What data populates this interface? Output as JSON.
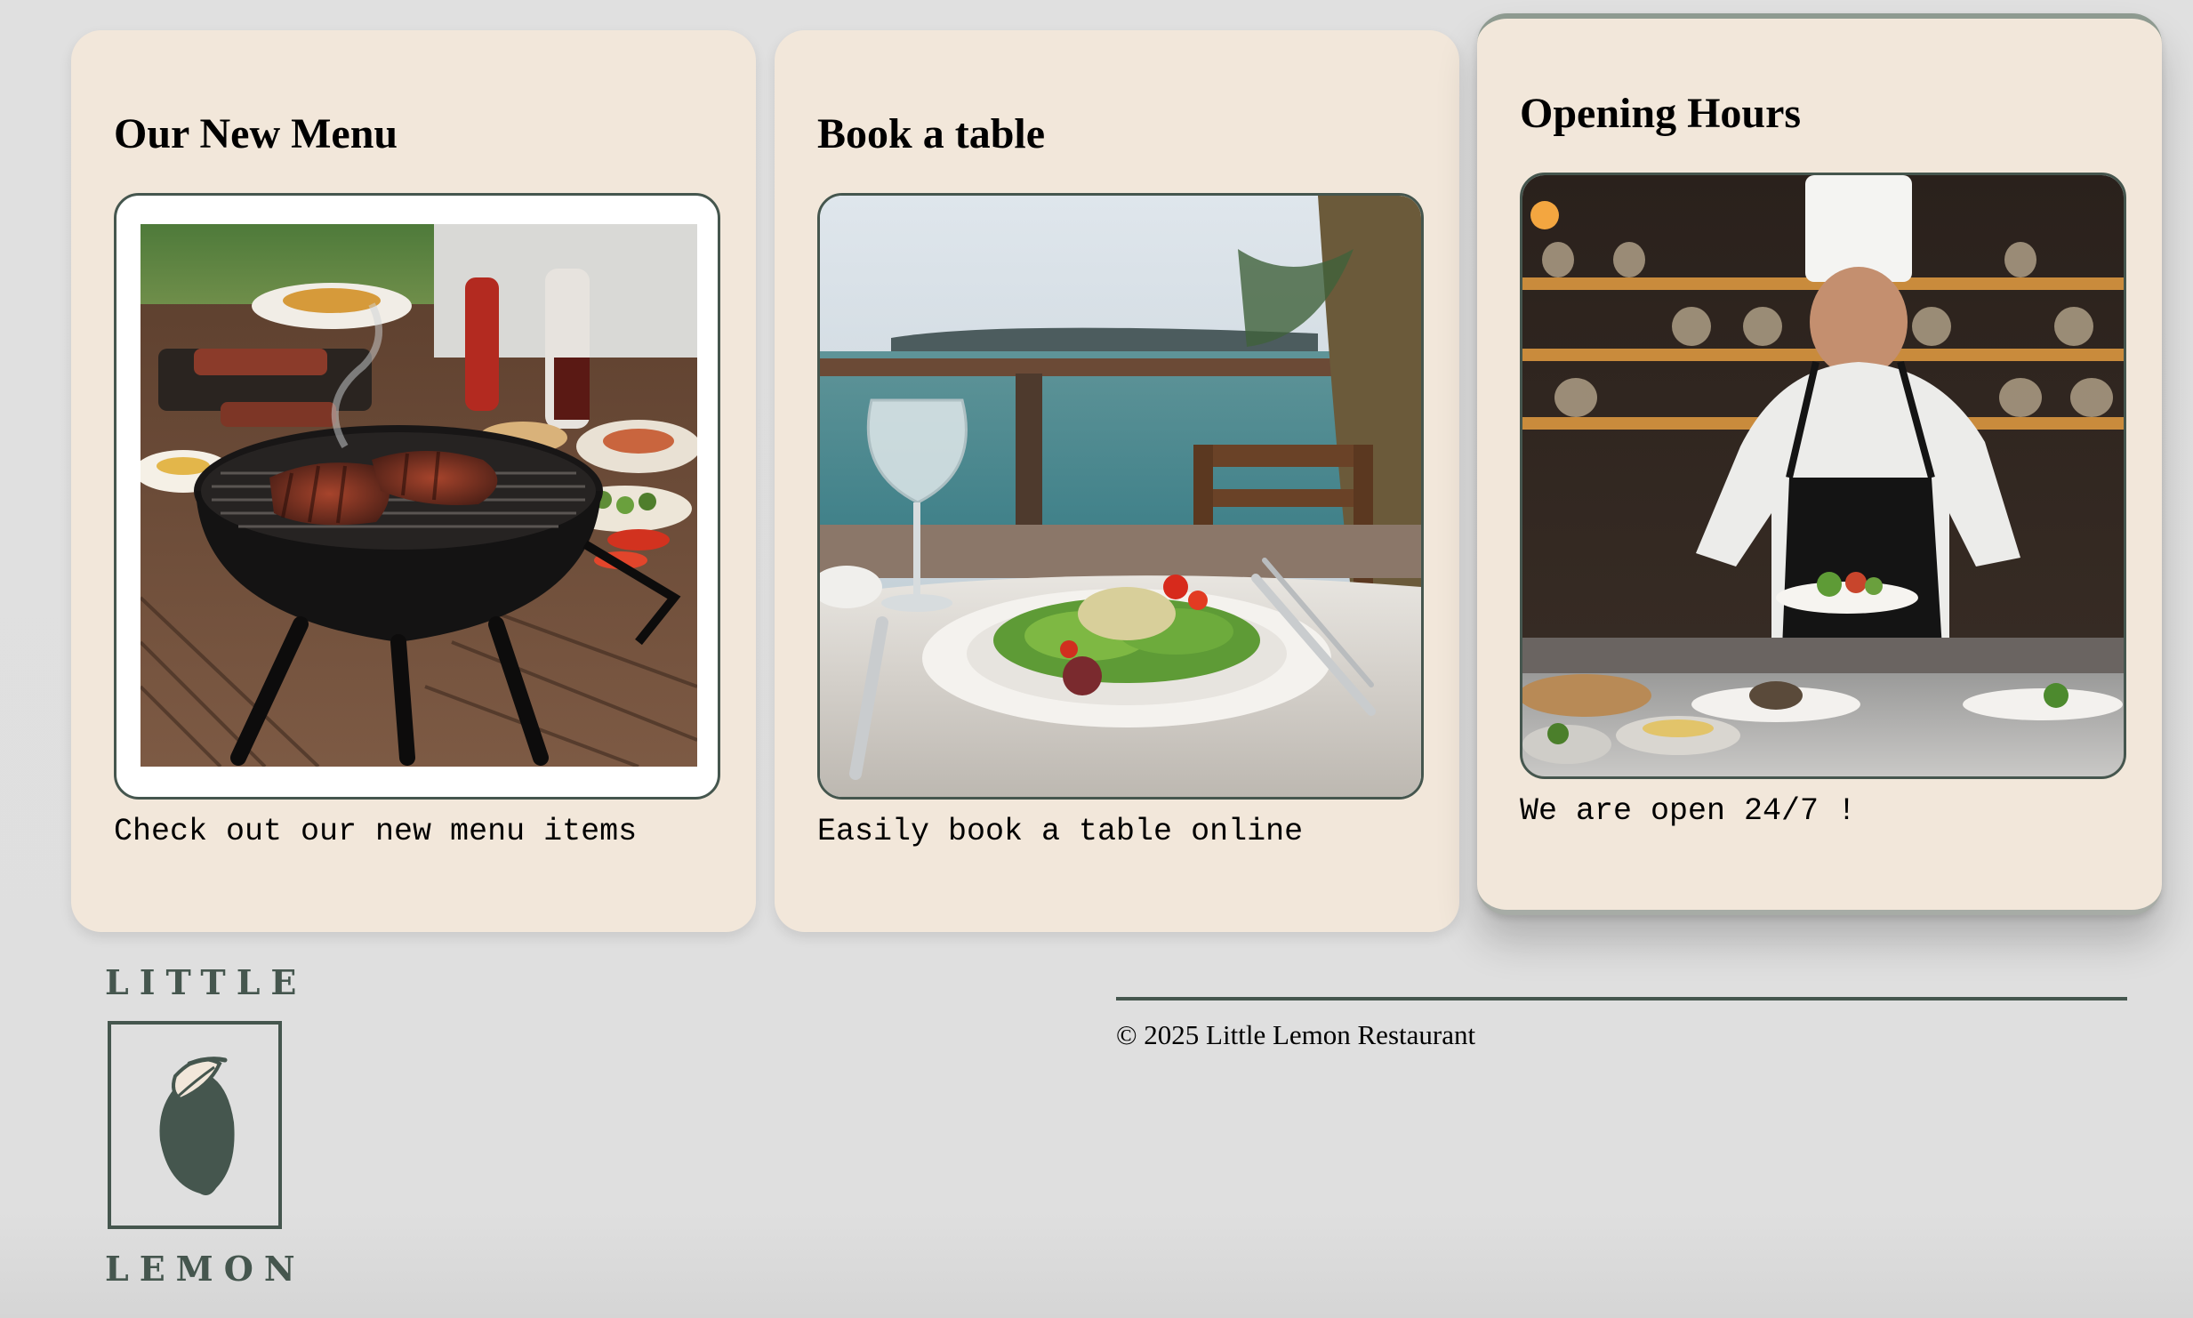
{
  "cards": [
    {
      "title": "Our New Menu",
      "description": "Check out our new menu items",
      "image": "grill-barbecue-photo"
    },
    {
      "title": "Book a table",
      "description": "Easily book a table online",
      "image": "seaside-salad-table-photo"
    },
    {
      "title": "Opening Hours",
      "description": "We are open 24/7 !",
      "image": "chef-plating-kitchen-photo"
    }
  ],
  "logo": {
    "top_word": "LITTLE",
    "bottom_word": "LEMON",
    "icon": "lemon-icon"
  },
  "footer": {
    "copyright": "© 2025 Little Lemon Restaurant"
  },
  "colors": {
    "page_background": "#e0e0e0",
    "card_background": "#f2e7da",
    "brand_green": "#45564e"
  }
}
